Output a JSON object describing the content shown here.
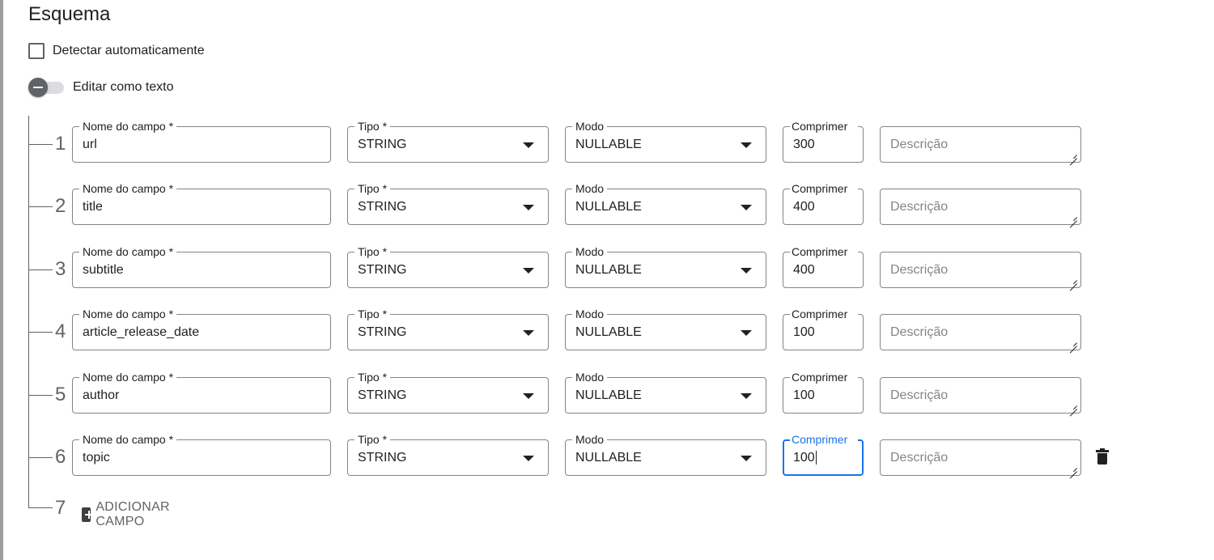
{
  "section": {
    "title": "Esquema",
    "auto_detect_label": "Detectar automaticamente",
    "edit_as_text_label": "Editar como texto"
  },
  "labels": {
    "name": "Nome do campo *",
    "type": "Tipo *",
    "mode": "Modo",
    "length": "Comprimer",
    "description_placeholder": "Descrição"
  },
  "fields": [
    {
      "num": "1",
      "name": "url",
      "type": "STRING",
      "mode": "NULLABLE",
      "length": "300"
    },
    {
      "num": "2",
      "name": "title",
      "type": "STRING",
      "mode": "NULLABLE",
      "length": "400"
    },
    {
      "num": "3",
      "name": "subtitle",
      "type": "STRING",
      "mode": "NULLABLE",
      "length": "400"
    },
    {
      "num": "4",
      "name": "article_release_date",
      "type": "STRING",
      "mode": "NULLABLE",
      "length": "100"
    },
    {
      "num": "5",
      "name": "author",
      "type": "STRING",
      "mode": "NULLABLE",
      "length": "100"
    },
    {
      "num": "6",
      "name": "topic",
      "type": "STRING",
      "mode": "NULLABLE",
      "length": "100"
    }
  ],
  "add_field": {
    "num": "7",
    "label": "ADICIONAR CAMPO"
  },
  "colors": {
    "focus": "#1a73e8",
    "border": "#80868b",
    "text": "#202124"
  },
  "icons": {
    "delete": "trash-icon",
    "add": "plus-box-icon",
    "dropdown": "arrow-drop-down-icon"
  }
}
